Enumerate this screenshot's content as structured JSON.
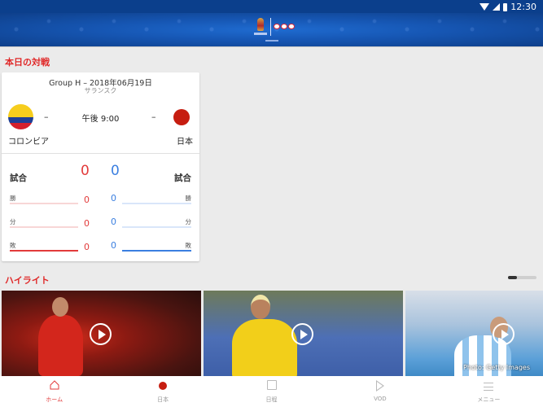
{
  "status_bar": {
    "time": "12:30",
    "icons": [
      "wifi-icon",
      "signal-icon",
      "battery-icon"
    ]
  },
  "header": {
    "logo": "fifa-world-cup-2018-nhk-logo"
  },
  "today_match": {
    "section_title": "本日の対戦",
    "match_info": "Group H – 2018年06月19日",
    "venue": "サランスク",
    "kickoff": "午後 9:00",
    "home": {
      "name": "コロンビア",
      "score": "–",
      "flag": "colombia-flag"
    },
    "away": {
      "name": "日本",
      "score": "–",
      "flag": "japan-flag"
    },
    "stats": {
      "matches_label": "試合",
      "home_matches": "0",
      "away_matches": "0",
      "rows": [
        {
          "label": "勝",
          "home": "0",
          "away": "0"
        },
        {
          "label": "分",
          "home": "0",
          "away": "0"
        },
        {
          "label": "敗",
          "home": "0",
          "away": "0"
        }
      ]
    },
    "colors": {
      "home": "#e23b3b",
      "away": "#3b7fe0"
    }
  },
  "highlights": {
    "section_title": "ハイライト",
    "pager": {
      "current": 1
    },
    "items": [
      {
        "subject": "spain-player",
        "play_icon": "play-icon"
      },
      {
        "subject": "brazil-player",
        "play_icon": "play-icon"
      },
      {
        "subject": "argentina-player",
        "play_icon": "play-icon",
        "credit": "Photo: Getty Images"
      }
    ]
  },
  "bottom_nav": {
    "items": [
      {
        "label": "ホーム",
        "icon": "home-icon",
        "active": true
      },
      {
        "label": "日本",
        "icon": "japan-dot-icon",
        "active": false
      },
      {
        "label": "日程",
        "icon": "calendar-icon",
        "active": false
      },
      {
        "label": "VOD",
        "icon": "play-outline-icon",
        "active": false
      },
      {
        "label": "メニュー",
        "icon": "menu-icon",
        "active": false
      }
    ]
  },
  "accent_color": "#e02828"
}
